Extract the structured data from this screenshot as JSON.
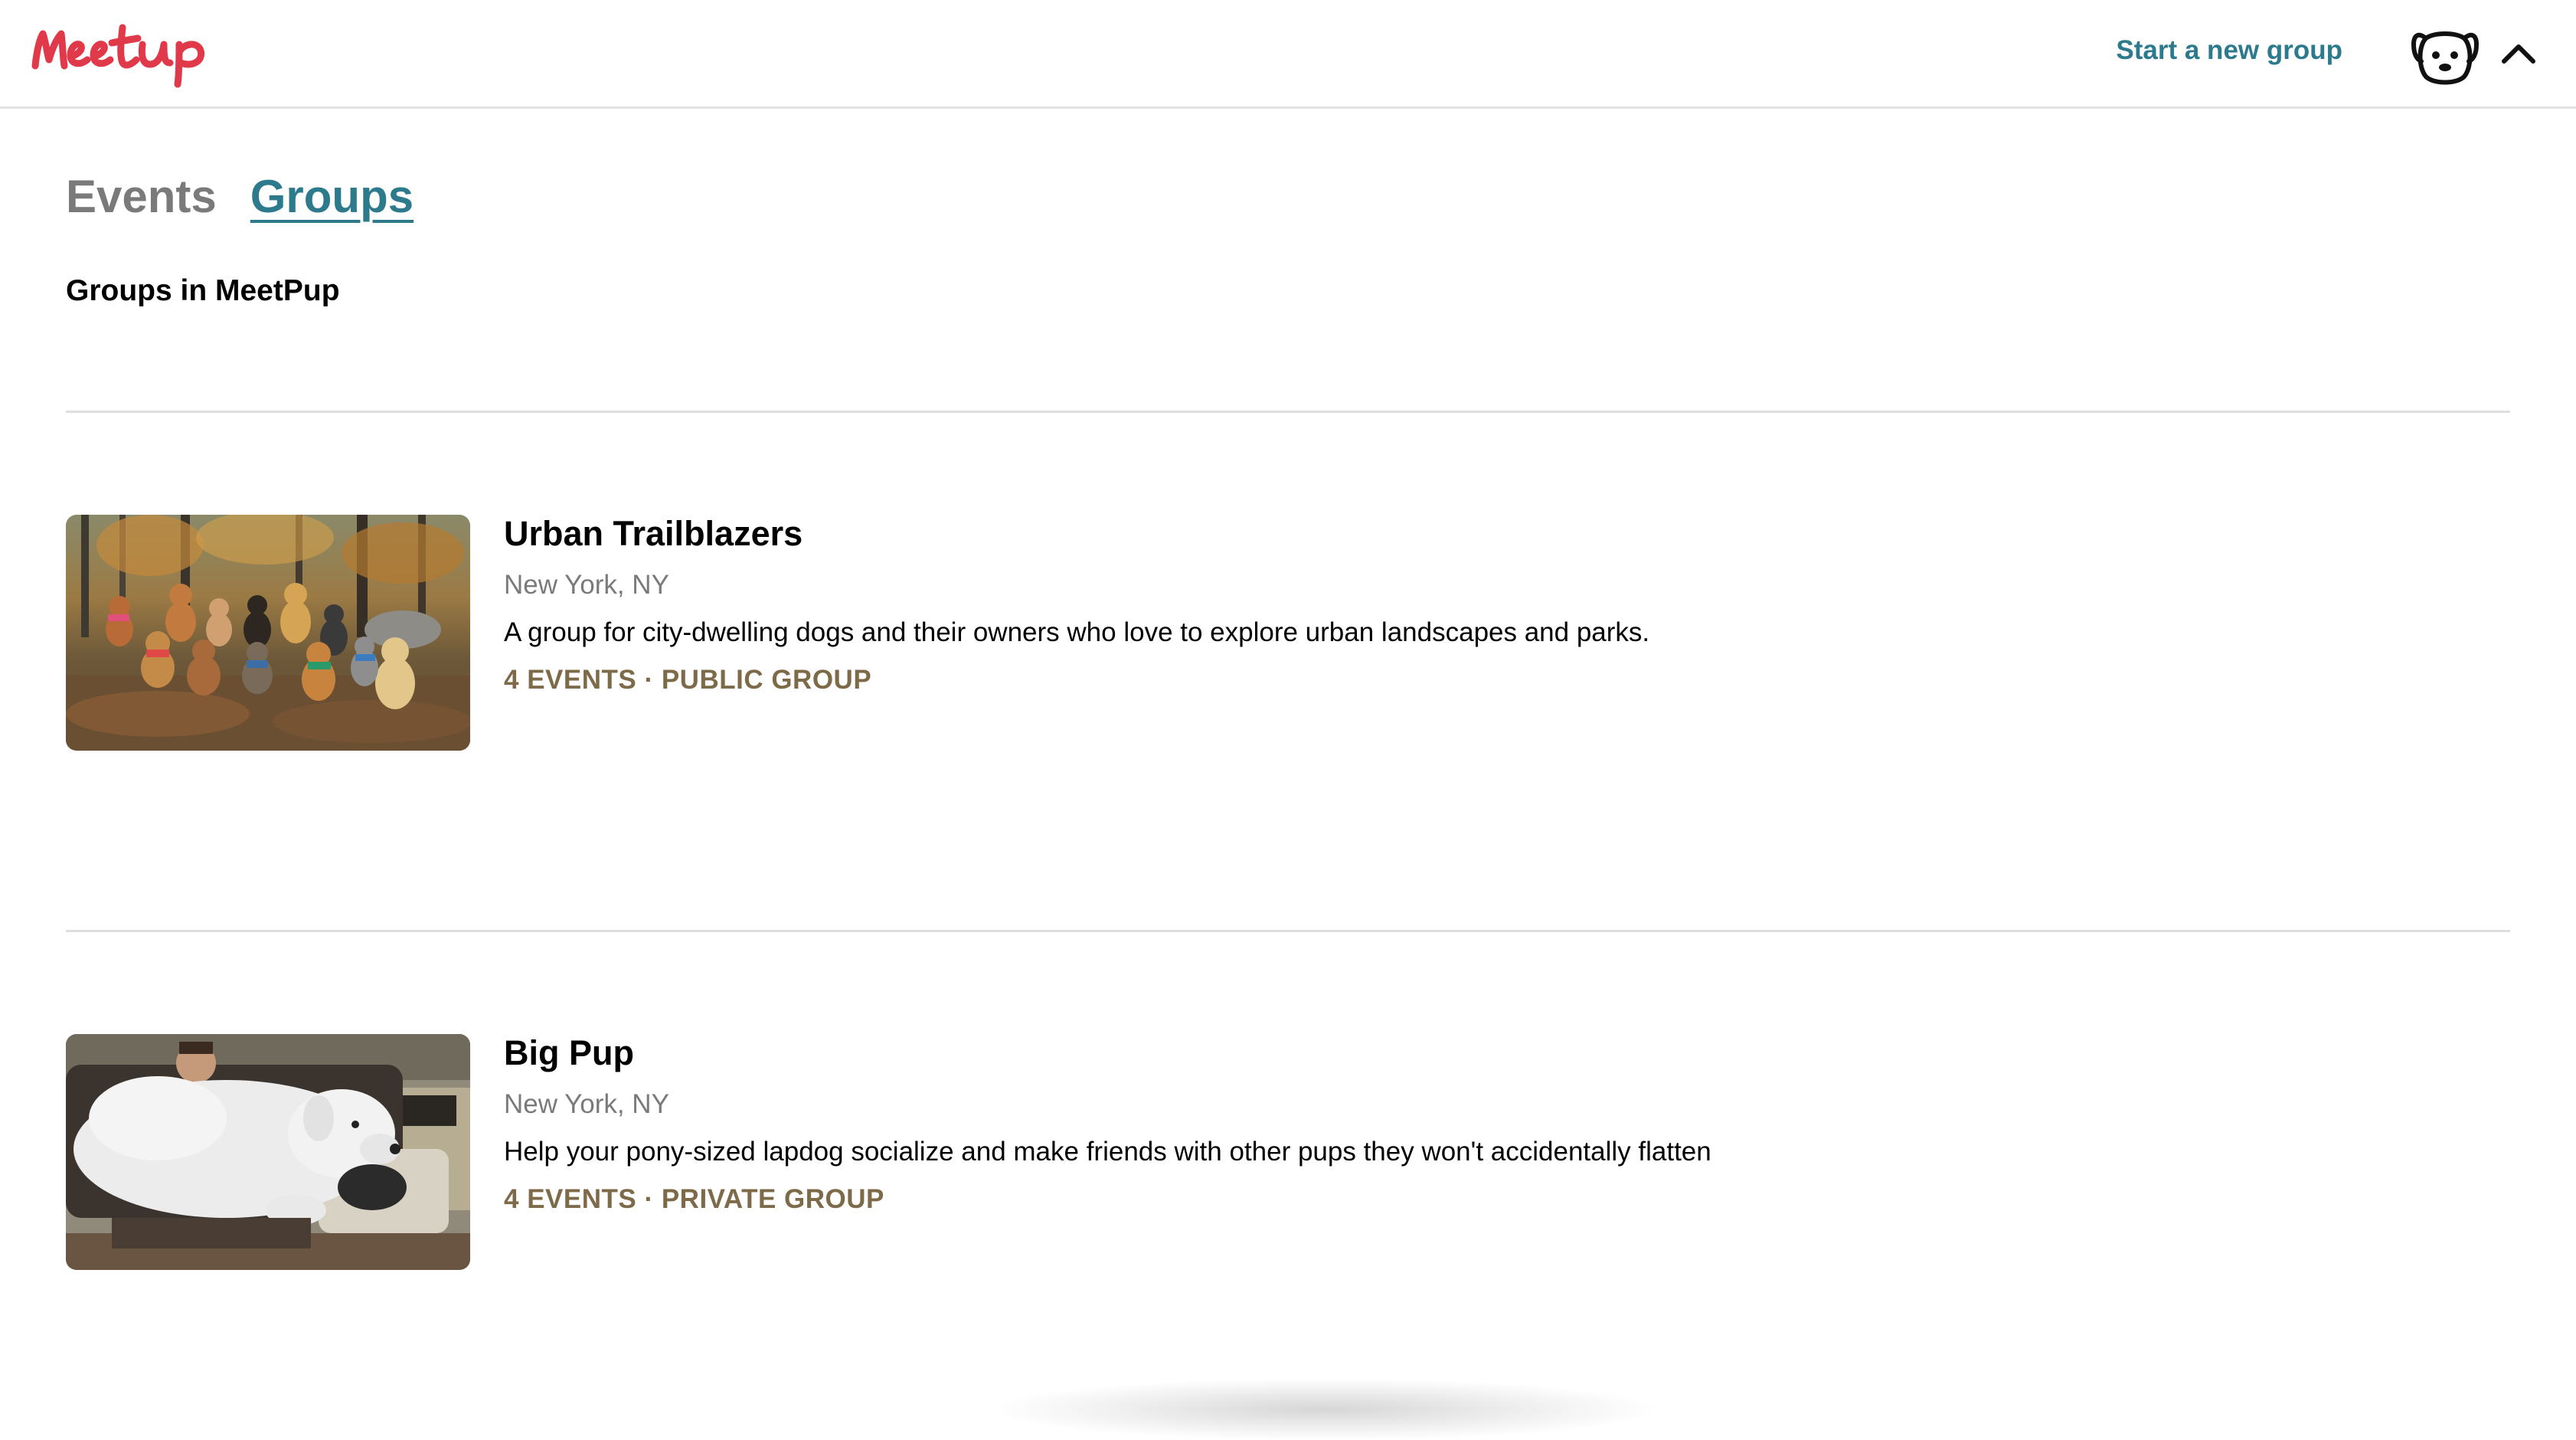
{
  "header": {
    "logo_text": "Meetup",
    "start_group_label": "Start a new group",
    "brand_color": "#e0394a",
    "link_color": "#2c7a8c"
  },
  "tabs": [
    {
      "label": "Events",
      "active": false
    },
    {
      "label": "Groups",
      "active": true
    }
  ],
  "section": {
    "heading": "Groups in MeetPup"
  },
  "groups": [
    {
      "name": "Urban Trailblazers",
      "location": "New York, NY",
      "description": "A group for city-dwelling dogs and their owners who love to explore urban landscapes and parks.",
      "meta": "4 EVENTS · PUBLIC GROUP",
      "image_icon": "pack-of-dogs-in-forest-photo"
    },
    {
      "name": "Big Pup",
      "location": "New York, NY",
      "description": "Help your pony-sized lapdog socialize and make friends with other pups they won't accidentally flatten",
      "meta": "4 EVENTS · PRIVATE GROUP",
      "image_icon": "large-white-dog-on-lap-photo"
    }
  ],
  "icons": {
    "avatar": "dog-face-icon",
    "menu_toggle": "chevron-up-icon"
  },
  "meta_color": "#7d6a48"
}
